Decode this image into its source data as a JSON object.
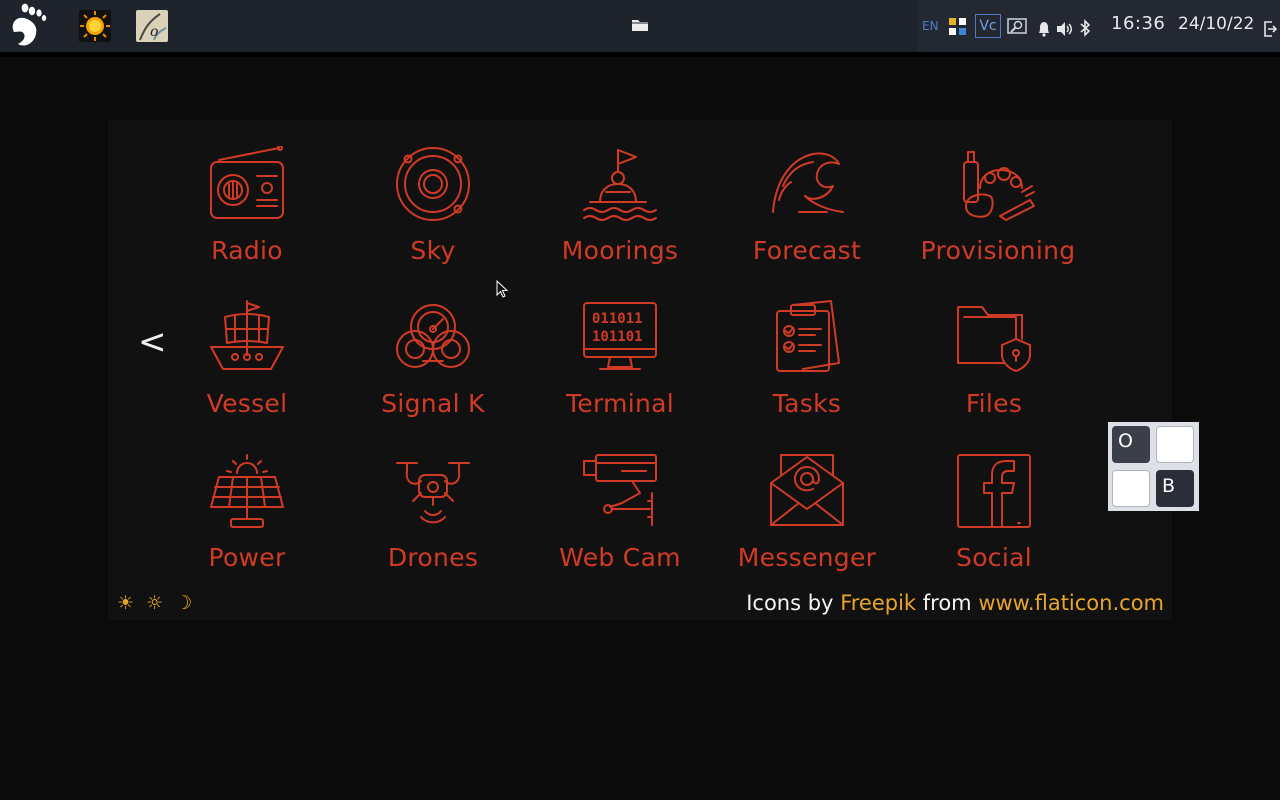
{
  "taskbar": {
    "launchers": [
      "weather-app",
      "chart-plotter-app"
    ],
    "tray": {
      "language": "EN",
      "vnc_label": "Vc",
      "time": "16:36",
      "date": "24/10/22"
    }
  },
  "apps": [
    {
      "label": "Radio",
      "icon": "radio-icon"
    },
    {
      "label": "Sky",
      "icon": "planet-orbit-icon"
    },
    {
      "label": "Moorings",
      "icon": "buoy-icon"
    },
    {
      "label": "Forecast",
      "icon": "wave-icon"
    },
    {
      "label": "Provisioning",
      "icon": "groceries-icon"
    },
    {
      "label": "Vessel",
      "icon": "sailing-ship-icon"
    },
    {
      "label": "Signal K",
      "icon": "gauge-icon"
    },
    {
      "label": "Terminal",
      "icon": "binary-monitor-icon"
    },
    {
      "label": "Tasks",
      "icon": "checklist-icon"
    },
    {
      "label": "Files",
      "icon": "secure-folder-icon"
    },
    {
      "label": "Power",
      "icon": "solar-panel-icon"
    },
    {
      "label": "Drones",
      "icon": "drone-icon"
    },
    {
      "label": "Web Cam",
      "icon": "security-camera-icon"
    },
    {
      "label": "Messenger",
      "icon": "email-envelope-icon"
    },
    {
      "label": "Social",
      "icon": "facebook-icon"
    }
  ],
  "navigation": {
    "prev_label": "<"
  },
  "themes": [
    "☀",
    "☼",
    "☽"
  ],
  "credits": {
    "prefix": "Icons by",
    "author": "Freepik",
    "middle": "from",
    "site": "www.flaticon.com"
  },
  "keyboard_widget": {
    "key_top_left": "O",
    "key_bottom_right": "B"
  },
  "colors": {
    "accent": "#d13b25",
    "link": "#e7a52c",
    "background": "#0b0b0c",
    "panel": "#111112"
  }
}
